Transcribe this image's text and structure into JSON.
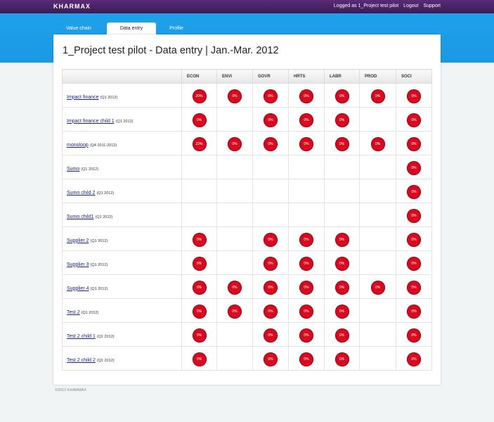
{
  "app": {
    "brand": "KHARMAX",
    "logged_as": "Logged as 1_Project test pilot",
    "logout": "Logout",
    "support": "Support"
  },
  "tabs": [
    {
      "label": "Value chain"
    },
    {
      "label": "Data entry",
      "active": true
    },
    {
      "label": "Profile"
    }
  ],
  "page": {
    "title": "1_Project test pilot - Data entry | Jan.-Mar. 2012"
  },
  "table": {
    "columns": [
      "ECON",
      "ENVI",
      "GOVR",
      "HRTS",
      "LABR",
      "PROD",
      "SOCI"
    ],
    "rows": [
      {
        "name": "Impact finance",
        "period": "(Q1 2012)",
        "values": [
          "20%",
          "0%",
          "0%",
          "0%",
          "0%",
          "0%",
          "0%"
        ]
      },
      {
        "name": "Impact finance child 1",
        "period": "(Q1 2012)",
        "values": [
          "0%",
          "",
          "0%",
          "0%",
          "0%",
          "",
          "0%"
        ]
      },
      {
        "name": "monoloop",
        "period": "(Q4 2011-2012)",
        "values": [
          "22%",
          "0%",
          "0%",
          "0%",
          "0%",
          "0%",
          "0%"
        ]
      },
      {
        "name": "Sumo",
        "period": "(Q1 2012)",
        "values": [
          "",
          "",
          "",
          "",
          "",
          "",
          "0%"
        ]
      },
      {
        "name": "Sumo child 2",
        "period": "(Q1 2012)",
        "values": [
          "",
          "",
          "",
          "",
          "",
          "",
          "0%"
        ]
      },
      {
        "name": "Sumo child1",
        "period": "(Q1 2012)",
        "values": [
          "",
          "",
          "",
          "",
          "",
          "",
          "0%"
        ]
      },
      {
        "name": "Supplier 2",
        "period": "(Q1 2012)",
        "values": [
          "0%",
          "",
          "0%",
          "0%",
          "0%",
          "",
          "0%"
        ]
      },
      {
        "name": "Supplier 3",
        "period": "(Q1 2012)",
        "values": [
          "0%",
          "",
          "0%",
          "0%",
          "0%",
          "",
          "0%"
        ]
      },
      {
        "name": "Supplier 4",
        "period": "(Q1 2012)",
        "values": [
          "0%",
          "0%",
          "0%",
          "0%",
          "0%",
          "0%",
          "0%"
        ]
      },
      {
        "name": "Test 2",
        "period": "(Q1 2012)",
        "values": [
          "0%",
          "0%",
          "0%",
          "0%",
          "0%",
          "",
          "0%"
        ]
      },
      {
        "name": "Test 2 child 1",
        "period": "(Q1 2012)",
        "values": [
          "0%",
          "",
          "0%",
          "0%",
          "0%",
          "",
          "0%"
        ]
      },
      {
        "name": "Test 2 child 2",
        "period": "(Q1 2012)",
        "values": [
          "0%",
          "",
          "0%",
          "0%",
          "0%",
          "",
          "0%"
        ]
      }
    ]
  },
  "footer": {
    "text": "©2012 KHARMAX"
  },
  "colors": {
    "topbar": "#4a2266",
    "band": "#1d9de8",
    "badge": "#d90a1f"
  }
}
